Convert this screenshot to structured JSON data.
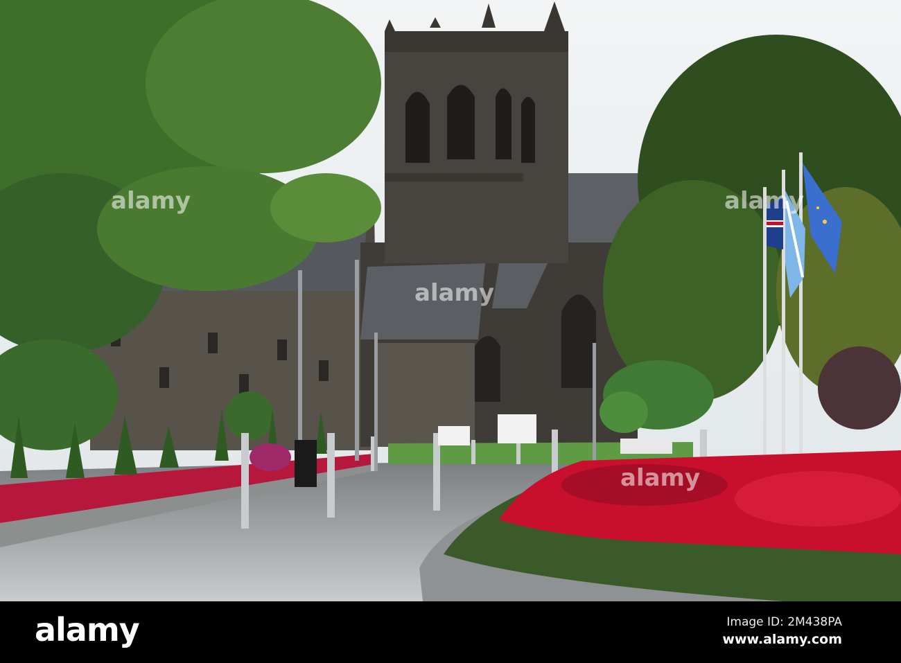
{
  "watermark": {
    "logo": "alamy",
    "overlay_text": "alamy"
  },
  "footer": {
    "image_id": "Image ID: 2M438PA",
    "site": "www.alamy.com"
  },
  "colors": {
    "sky": "#eef1f2",
    "stone": "#4a4640",
    "roof": "#5a5d62",
    "foliage": "#3d6b28",
    "flowers": "#c8102e",
    "pavement": "#b9bcbf"
  }
}
